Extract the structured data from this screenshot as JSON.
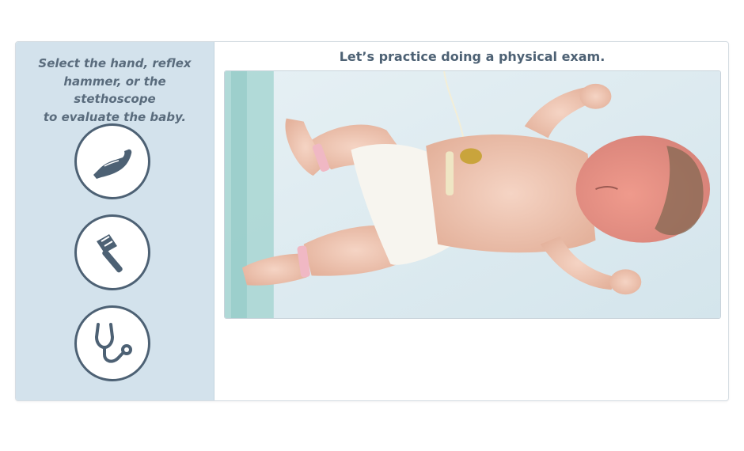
{
  "sidebar": {
    "instructions": "Select the hand, reflex\nhammer, or the stethoscope\nto evaluate the baby.",
    "tools": [
      {
        "name": "hand",
        "icon": "hand-icon"
      },
      {
        "name": "reflex hammer",
        "icon": "reflex-hammer-icon"
      },
      {
        "name": "stethoscope",
        "icon": "stethoscope-icon"
      }
    ]
  },
  "main": {
    "title": "Let’s practice doing a physical exam."
  },
  "colors": {
    "sidebar_bg": "#d3e2ec",
    "accent": "#4d6174",
    "instruction_text": "#5a6c7d"
  }
}
